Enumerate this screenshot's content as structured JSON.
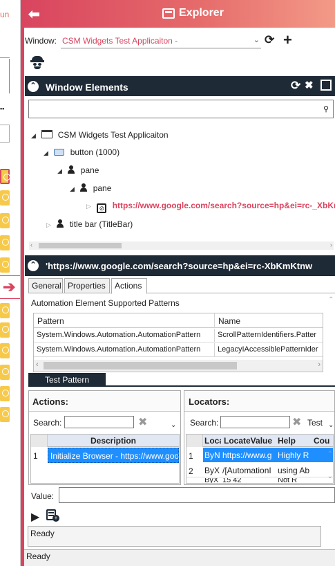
{
  "left_strip": {
    "run_label": "un"
  },
  "titlebar": {
    "back_icon": "arrow-left-icon",
    "title": "Explorer"
  },
  "window_row": {
    "label": "Window:",
    "value": "CSM Widgets Test Applicaiton -"
  },
  "window_elements": {
    "title": "Window Elements",
    "search_placeholder": "",
    "tree": {
      "root": "CSM Widgets Test Applicaiton",
      "button": "button (1000)",
      "pane1": "pane",
      "pane2": "pane",
      "link": "https://www.google.com/search?source=hp&ei=rc-_XbKmK",
      "titlebar_node": "title bar (TitleBar)"
    }
  },
  "element_panel": {
    "title": "'https://www.google.com/search?source=hp&ei=rc-XbKmKtnw",
    "tabs": [
      "General",
      "Properties",
      "Actions"
    ],
    "active_tab": "Actions",
    "patterns_label": "Automation Element Supported Patterns",
    "patterns_grid": {
      "headers": [
        "Pattern",
        "Name"
      ],
      "rows": [
        [
          "System.Windows.Automation.AutomationPattern",
          "ScrollPatternIdentifiers.Patter"
        ],
        [
          "System.Windows.Automation.AutomationPattern",
          "LegacyIAccessiblePatternIder"
        ]
      ]
    },
    "test_pattern_tab": "Test Pattern"
  },
  "actions": {
    "title": "Actions:",
    "search_label": "Search:",
    "search_value": "",
    "grid_header": "Description",
    "rows": [
      {
        "num": "1",
        "description": "Initialize Browser - https://www.goo"
      }
    ]
  },
  "locators": {
    "title": "Locators:",
    "search_label": "Search:",
    "search_value": "",
    "test_label": "Test",
    "headers": [
      "Loca",
      "LocateValue",
      "Help",
      "Cou"
    ],
    "rows": [
      {
        "num": "1",
        "loc": "ByN",
        "value": "https://www.g",
        "help": "Highly R"
      },
      {
        "num": "2",
        "loc": "ByX",
        "value": "/[AutomationI",
        "help": "using Ab"
      },
      {
        "num": "",
        "loc": "ByX",
        "value": "15 42",
        "help": "Not R"
      }
    ]
  },
  "value_row": {
    "label": "Value:",
    "value": ""
  },
  "status": {
    "inner": "Ready",
    "outer": "Ready"
  }
}
